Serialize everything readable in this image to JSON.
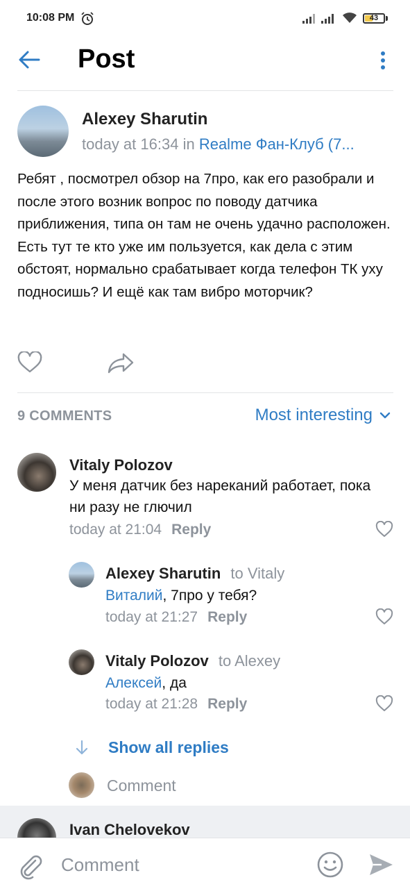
{
  "status_bar": {
    "time": "10:08 PM",
    "battery": "43",
    "battery_level": 0.43
  },
  "header": {
    "title": "Post"
  },
  "post": {
    "author": "Alexey Sharutin",
    "time": "today at 16:34",
    "in_word": "in",
    "community": "Realme Фан-Клуб (7...",
    "text": "Ребят , посмотрел обзор на 7про, как его разобрали и после этого возник вопрос по поводу датчика приближения, типа он там не очень удачно расположен. Есть тут те кто уже им пользуется, как дела с этим обстоят, нормально срабатывает когда телефон ТК уху подносишь? И ещё как там вибро моторчик?"
  },
  "comments_section": {
    "count_label": "9 COMMENTS",
    "sort_label": "Most interesting"
  },
  "comments": [
    {
      "author": "Vitaly Polozov",
      "to": "",
      "mention": "",
      "text": "У меня датчик без нареканий работает, пока ни разу не глючил",
      "time": "today at 21:04",
      "reply": "Reply"
    },
    {
      "author": "Alexey Sharutin",
      "to": "to Vitaly",
      "mention": "Виталий",
      "text": ", 7про у тебя?",
      "time": "today at 21:27",
      "reply": "Reply"
    },
    {
      "author": "Vitaly Polozov",
      "to": "to Alexey",
      "mention": "Алексей",
      "text": ", да",
      "time": "today at 21:28",
      "reply": "Reply"
    }
  ],
  "show_all_replies": "Show all replies",
  "comment_prompt": "Comment",
  "next_comment_author": "Ivan Chelovekov",
  "bottom_bar": {
    "placeholder": "Comment"
  }
}
